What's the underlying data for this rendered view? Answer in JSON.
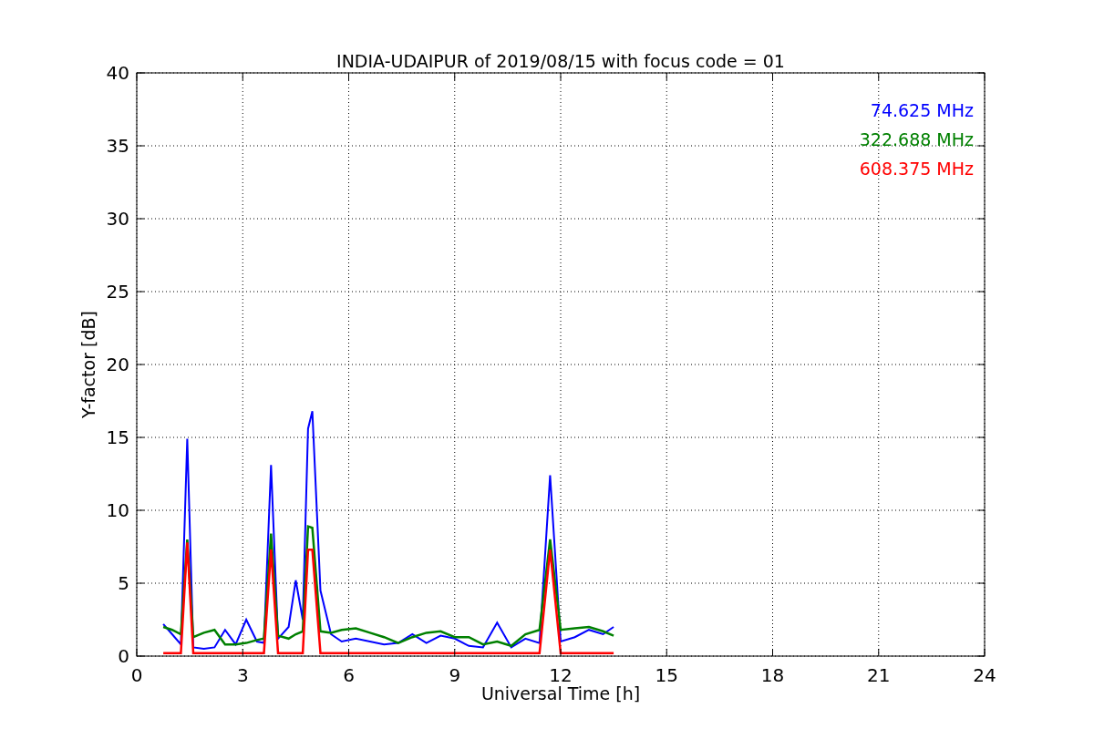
{
  "figure": {
    "chart_data": {
      "type": "line",
      "title": "INDIA-UDAIPUR of 2019/08/15 with focus code = 01",
      "xlabel": "Universal Time [h]",
      "ylabel": "Y-factor [dB]",
      "x": [
        0.75,
        1.0,
        1.25,
        1.43,
        1.6,
        1.9,
        2.2,
        2.5,
        2.8,
        3.1,
        3.4,
        3.6,
        3.8,
        4.0,
        4.3,
        4.5,
        4.7,
        4.85,
        4.97,
        5.2,
        5.5,
        5.8,
        6.2,
        6.6,
        7.0,
        7.4,
        7.8,
        8.2,
        8.6,
        9.0,
        9.4,
        9.8,
        10.2,
        10.6,
        11.0,
        11.4,
        11.7,
        12.0,
        12.4,
        12.8,
        13.2,
        13.5
      ],
      "series": [
        {
          "name": "74.625 MHz",
          "color": "#0000ff",
          "values": [
            2.2,
            1.5,
            0.8,
            14.9,
            0.6,
            0.5,
            0.6,
            1.8,
            0.8,
            2.5,
            1.0,
            0.9,
            13.1,
            1.2,
            2.0,
            5.2,
            2.5,
            15.6,
            16.8,
            4.5,
            1.5,
            1.0,
            1.2,
            1.0,
            0.8,
            0.9,
            1.5,
            0.9,
            1.4,
            1.2,
            0.7,
            0.6,
            2.3,
            0.6,
            1.2,
            0.9,
            12.4,
            1.0,
            1.3,
            1.8,
            1.5,
            2.0
          ]
        },
        {
          "name": "322.688 MHz",
          "color": "#008000",
          "values": [
            2.0,
            1.8,
            1.5,
            8.0,
            1.3,
            1.6,
            1.8,
            0.8,
            0.8,
            0.9,
            1.1,
            1.2,
            8.4,
            1.4,
            1.2,
            1.5,
            1.7,
            8.9,
            8.8,
            1.7,
            1.6,
            1.8,
            1.9,
            1.6,
            1.3,
            0.9,
            1.3,
            1.6,
            1.7,
            1.3,
            1.3,
            0.8,
            1.0,
            0.7,
            1.5,
            1.8,
            8.0,
            1.8,
            1.9,
            2.0,
            1.7,
            1.4
          ]
        },
        {
          "name": "608.375 MHz",
          "color": "#ff0000",
          "values": [
            0.2,
            0.2,
            0.2,
            7.8,
            0.2,
            0.2,
            0.2,
            0.2,
            0.2,
            0.2,
            0.2,
            0.2,
            7.3,
            0.2,
            0.2,
            0.2,
            0.2,
            7.3,
            7.3,
            0.2,
            0.2,
            0.2,
            0.2,
            0.2,
            0.2,
            0.2,
            0.2,
            0.2,
            0.2,
            0.2,
            0.2,
            0.2,
            0.2,
            0.2,
            0.2,
            0.2,
            7.3,
            0.2,
            0.2,
            0.2,
            0.2,
            0.2
          ]
        }
      ],
      "xlim": [
        0,
        24
      ],
      "ylim": [
        0,
        40
      ],
      "grid": true,
      "xticks": [
        0,
        3,
        6,
        9,
        12,
        15,
        18,
        21,
        24
      ],
      "yticks": [
        0,
        5,
        10,
        15,
        20,
        25,
        30,
        35,
        40
      ]
    }
  }
}
